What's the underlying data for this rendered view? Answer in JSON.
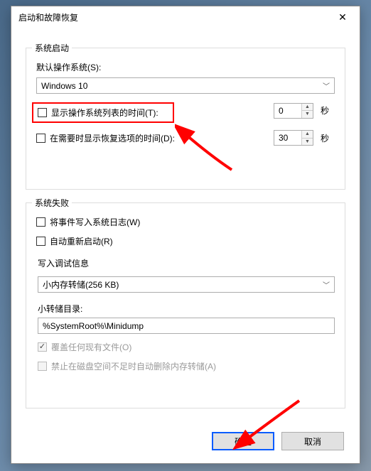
{
  "dialog": {
    "title": "启动和故障恢复"
  },
  "system_startup": {
    "legend": "系统启动",
    "default_os_label": "默认操作系统(S):",
    "default_os_value": "Windows 10",
    "show_os_list_label": "显示操作系统列表的时间(T):",
    "show_os_list_value": "0",
    "show_recovery_label": "在需要时显示恢复选项的时间(D):",
    "show_recovery_value": "30",
    "seconds_unit": "秒"
  },
  "system_failure": {
    "legend": "系统失败",
    "write_event_label": "将事件写入系统日志(W)",
    "auto_restart_label": "自动重新启动(R)",
    "debug_info_label": "写入调试信息",
    "debug_type_value": "小内存转储(256 KB)",
    "dump_dir_label": "小转储目录:",
    "dump_dir_value": "%SystemRoot%\\Minidump",
    "overwrite_label": "覆盖任何现有文件(O)",
    "no_auto_delete_label": "禁止在磁盘空间不足时自动删除内存转储(A)"
  },
  "buttons": {
    "ok": "确定",
    "cancel": "取消"
  }
}
